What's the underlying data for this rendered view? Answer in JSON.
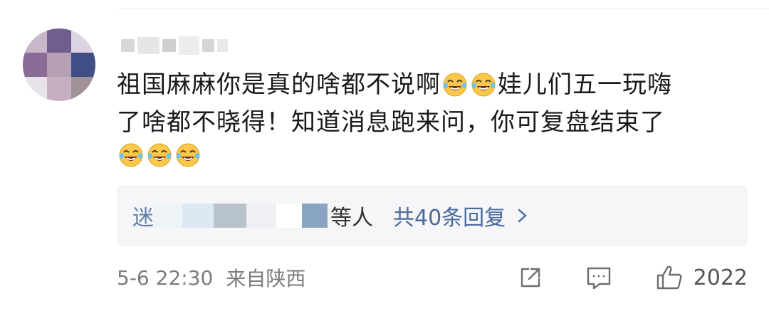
{
  "comment": {
    "line1": "祖国麻麻你是真的啥都不说啊",
    "line1_after": "娃儿们五一玩嗨",
    "line2": "了啥都不晓得！知道消息跑来问，你可复盘结束了",
    "emoji_name": "laugh-cry-emoji"
  },
  "replies": {
    "first_char": "迷",
    "people_suffix": "等人",
    "count_label": "共40条回复",
    "chevron_icon": "chevron-right-icon"
  },
  "footer": {
    "time": "5-6 22:30",
    "location": "来自陕西",
    "likes": "2022"
  },
  "icons": {
    "share": "share-icon",
    "comment": "comment-icon",
    "like": "thumbs-up-icon"
  },
  "colors": {
    "link": "#4a6b9c",
    "text": "#1a1a1a",
    "meta": "#7c7c7c",
    "reply_bg": "#f6f6f8"
  }
}
